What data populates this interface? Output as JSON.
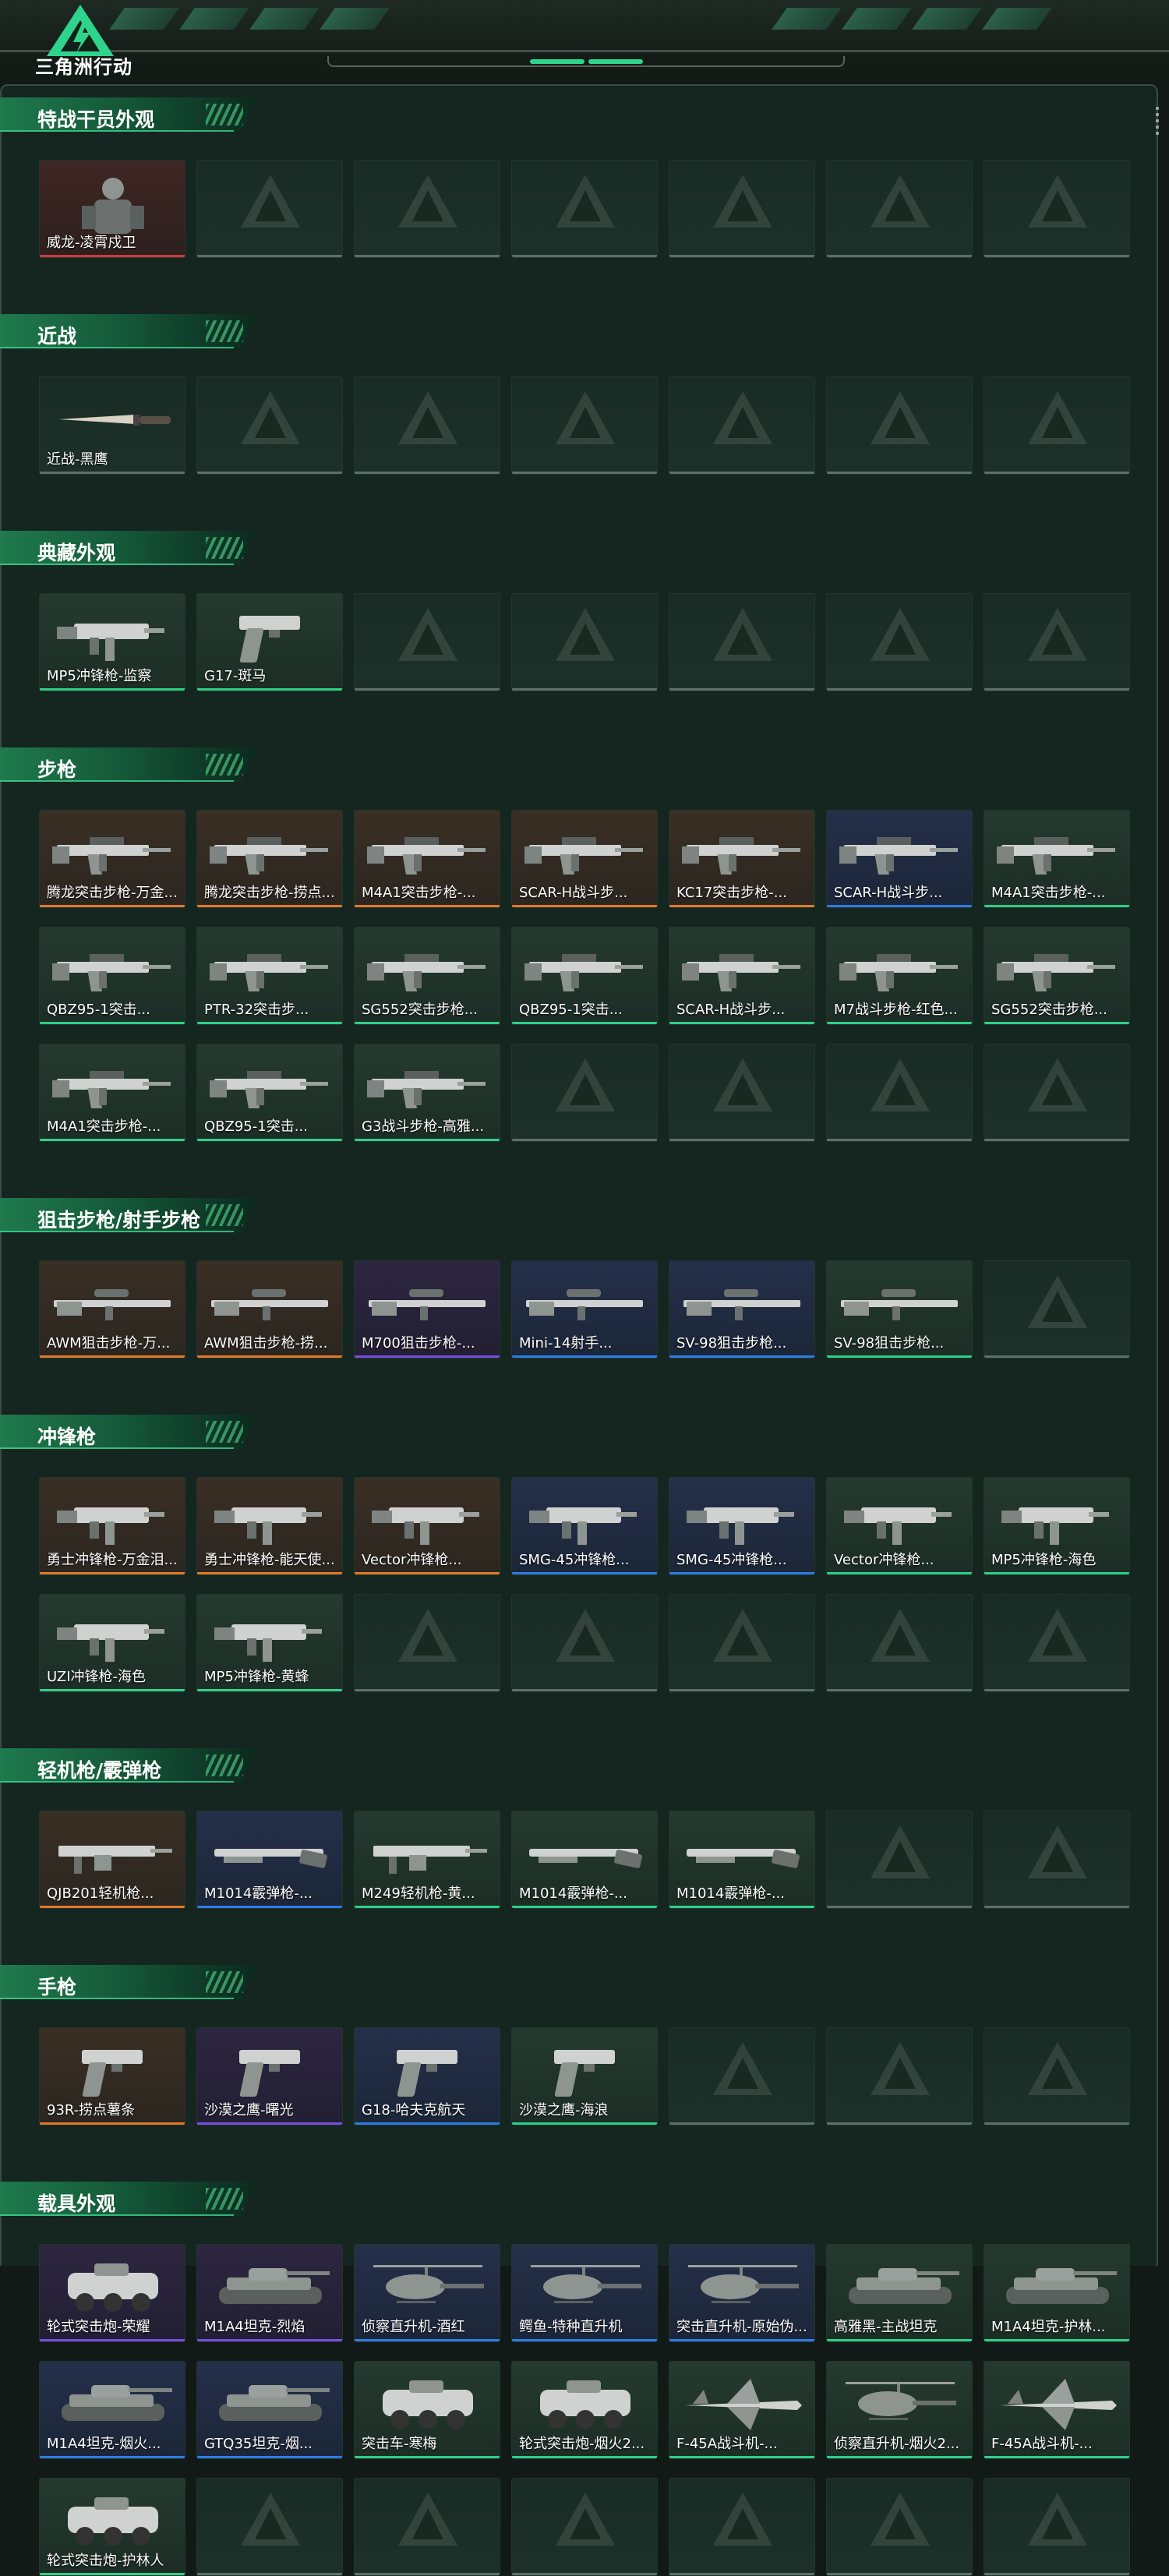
{
  "app": {
    "logo_text": "三角洲行动"
  },
  "colors": {
    "accent": "#2fcf88",
    "gold": "#e07a2a",
    "red": "#d33b3b",
    "purple": "#7a4ce0",
    "blue": "#2f7be6",
    "grey": "#7a8a84"
  },
  "sections": [
    {
      "title": "特战干员外观",
      "items": [
        {
          "name": "威龙-凌霄戍卫",
          "quality": "red",
          "icon": "operator-icon"
        }
      ]
    },
    {
      "title": "近战",
      "items": [
        {
          "name": "近战-黑鹰",
          "quality": "empty",
          "icon": "knife-icon"
        }
      ]
    },
    {
      "title": "典藏外观",
      "items": [
        {
          "name": "MP5冲锋枪-监察",
          "quality": "green",
          "icon": "smg-icon"
        },
        {
          "name": "G17-斑马",
          "quality": "green",
          "icon": "pistol-icon"
        }
      ]
    },
    {
      "title": "步枪",
      "items": [
        {
          "name": "腾龙突击步枪-万金...",
          "quality": "gold",
          "icon": "rifle-icon"
        },
        {
          "name": "腾龙突击步枪-捞点...",
          "quality": "gold",
          "icon": "rifle-icon"
        },
        {
          "name": "M4A1突击步枪-...",
          "quality": "gold",
          "icon": "rifle-icon"
        },
        {
          "name": "SCAR-H战斗步...",
          "quality": "gold",
          "icon": "rifle-icon"
        },
        {
          "name": "KC17突击步枪-...",
          "quality": "gold",
          "icon": "rifle-icon"
        },
        {
          "name": "SCAR-H战斗步...",
          "quality": "blue",
          "icon": "rifle-icon"
        },
        {
          "name": "M4A1突击步枪-...",
          "quality": "green",
          "icon": "rifle-icon"
        },
        {
          "name": "QBZ95-1突击...",
          "quality": "green",
          "icon": "rifle-icon"
        },
        {
          "name": "PTR-32突击步...",
          "quality": "green",
          "icon": "rifle-icon"
        },
        {
          "name": "SG552突击步枪...",
          "quality": "green",
          "icon": "rifle-icon"
        },
        {
          "name": "QBZ95-1突击...",
          "quality": "green",
          "icon": "rifle-icon"
        },
        {
          "name": "SCAR-H战斗步...",
          "quality": "green",
          "icon": "rifle-icon"
        },
        {
          "name": "M7战斗步枪-红色...",
          "quality": "green",
          "icon": "rifle-icon"
        },
        {
          "name": "SG552突击步枪...",
          "quality": "green",
          "icon": "rifle-icon"
        },
        {
          "name": "M4A1突击步枪-...",
          "quality": "green",
          "icon": "rifle-icon"
        },
        {
          "name": "QBZ95-1突击...",
          "quality": "green",
          "icon": "rifle-icon"
        },
        {
          "name": "G3战斗步枪-高雅...",
          "quality": "green",
          "icon": "rifle-icon"
        }
      ]
    },
    {
      "title": "狙击步枪/射手步枪",
      "items": [
        {
          "name": "AWM狙击步枪-万...",
          "quality": "gold",
          "icon": "sniper-icon"
        },
        {
          "name": "AWM狙击步枪-捞...",
          "quality": "gold",
          "icon": "sniper-icon"
        },
        {
          "name": "M700狙击步枪-...",
          "quality": "purple",
          "icon": "sniper-icon"
        },
        {
          "name": "Mini-14射手...",
          "quality": "blue",
          "icon": "sniper-icon"
        },
        {
          "name": "SV-98狙击步枪...",
          "quality": "blue",
          "icon": "sniper-icon"
        },
        {
          "name": "SV-98狙击步枪...",
          "quality": "green",
          "icon": "sniper-icon"
        }
      ]
    },
    {
      "title": "冲锋枪",
      "items": [
        {
          "name": "勇士冲锋枪-万金泪...",
          "quality": "gold",
          "icon": "smg-icon"
        },
        {
          "name": "勇士冲锋枪-能天使...",
          "quality": "gold",
          "icon": "smg-icon"
        },
        {
          "name": "Vector冲锋枪...",
          "quality": "gold",
          "icon": "smg-icon"
        },
        {
          "name": "SMG-45冲锋枪...",
          "quality": "blue",
          "icon": "smg-icon"
        },
        {
          "name": "SMG-45冲锋枪...",
          "quality": "blue",
          "icon": "smg-icon"
        },
        {
          "name": "Vector冲锋枪...",
          "quality": "green",
          "icon": "smg-icon"
        },
        {
          "name": "MP5冲锋枪-海色",
          "quality": "green",
          "icon": "smg-icon"
        },
        {
          "name": "UZI冲锋枪-海色",
          "quality": "green",
          "icon": "smg-icon"
        },
        {
          "name": "MP5冲锋枪-黄蜂",
          "quality": "green",
          "icon": "smg-icon"
        }
      ]
    },
    {
      "title": "轻机枪/霰弹枪",
      "items": [
        {
          "name": "QJB201轻机枪...",
          "quality": "gold",
          "icon": "lmg-icon"
        },
        {
          "name": "M1014霰弹枪-...",
          "quality": "blue",
          "icon": "shotgun-icon"
        },
        {
          "name": "M249轻机枪-黄...",
          "quality": "green",
          "icon": "lmg-icon"
        },
        {
          "name": "M1014霰弹枪-...",
          "quality": "green",
          "icon": "shotgun-icon"
        },
        {
          "name": "M1014霰弹枪-...",
          "quality": "green",
          "icon": "shotgun-icon"
        }
      ]
    },
    {
      "title": "手枪",
      "items": [
        {
          "name": "93R-捞点薯条",
          "quality": "gold",
          "icon": "pistol-icon"
        },
        {
          "name": "沙漠之鹰-曙光",
          "quality": "purple",
          "icon": "pistol-icon"
        },
        {
          "name": "G18-哈夫克航天",
          "quality": "blue",
          "icon": "pistol-icon"
        },
        {
          "name": "沙漠之鹰-海浪",
          "quality": "green",
          "icon": "pistol-icon"
        }
      ]
    },
    {
      "title": "载具外观",
      "items": [
        {
          "name": "轮式突击炮-荣耀",
          "quality": "purple",
          "icon": "vehicle-icon"
        },
        {
          "name": "M1A4坦克-烈焰",
          "quality": "purple",
          "icon": "tank-icon"
        },
        {
          "name": "侦察直升机-酒红",
          "quality": "blue",
          "icon": "helicopter-icon"
        },
        {
          "name": "鳄鱼-特种直升机",
          "quality": "blue",
          "icon": "helicopter-icon"
        },
        {
          "name": "突击直升机-原始伪...",
          "quality": "blue",
          "icon": "helicopter-icon"
        },
        {
          "name": "高雅黑-主战坦克",
          "quality": "green",
          "icon": "tank-icon"
        },
        {
          "name": "M1A4坦克-护林...",
          "quality": "green",
          "icon": "tank-icon"
        },
        {
          "name": "M1A4坦克-烟火...",
          "quality": "blue",
          "icon": "tank-icon"
        },
        {
          "name": "GTQ35坦克-烟...",
          "quality": "blue",
          "icon": "tank-icon"
        },
        {
          "name": "突击车-寒梅",
          "quality": "green",
          "icon": "vehicle-icon"
        },
        {
          "name": "轮式突击炮-烟火2...",
          "quality": "green",
          "icon": "vehicle-icon"
        },
        {
          "name": "F-45A战斗机-...",
          "quality": "green",
          "icon": "jet-icon"
        },
        {
          "name": "侦察直升机-烟火2...",
          "quality": "green",
          "icon": "helicopter-icon"
        },
        {
          "name": "F-45A战斗机-...",
          "quality": "green",
          "icon": "jet-icon"
        },
        {
          "name": "轮式突击炮-护林人",
          "quality": "green",
          "icon": "vehicle-icon"
        }
      ]
    }
  ]
}
